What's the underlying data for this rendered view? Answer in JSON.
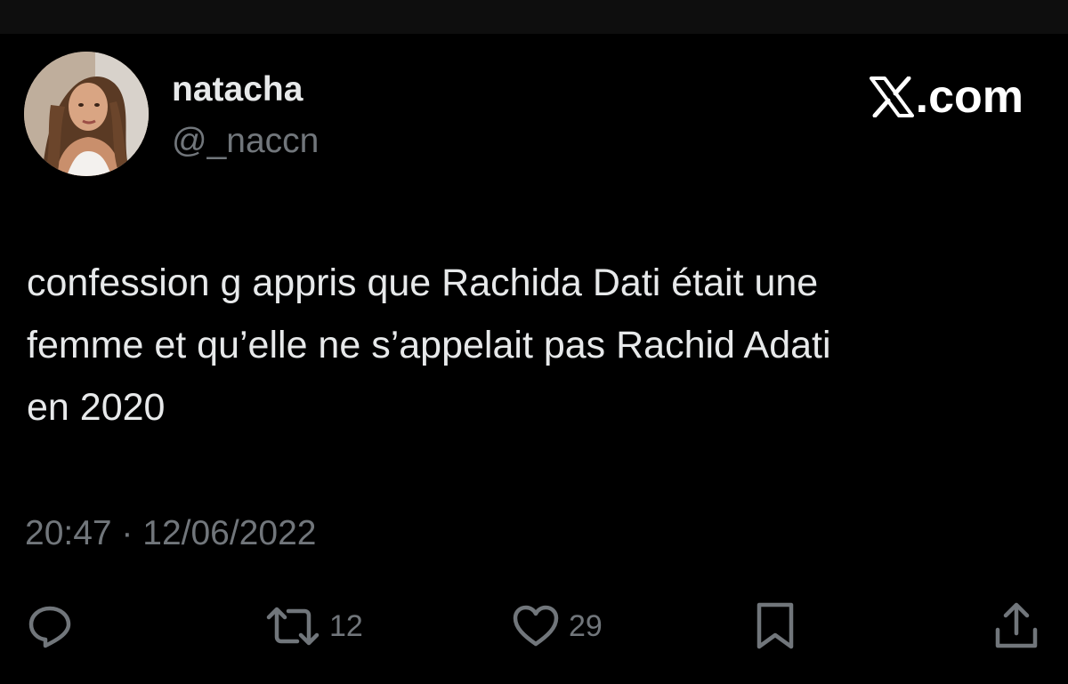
{
  "brand": {
    "logo_icon": "x-logo-icon",
    "domain_text": ".com"
  },
  "author": {
    "display_name": "natacha",
    "handle": "@_naccn",
    "avatar_icon": "profile-photo"
  },
  "tweet": {
    "text_lines": [
      "confession g appris que Rachida Dati était une",
      "femme et qu’elle ne s’appelait pas Rachid Adati",
      "en 2020"
    ],
    "timestamp": "20:47 · 12/06/2022"
  },
  "actions": {
    "reply": {
      "icon": "reply-icon"
    },
    "retweet": {
      "icon": "retweet-icon",
      "count": "12"
    },
    "like": {
      "icon": "heart-icon",
      "count": "29"
    },
    "bookmark": {
      "icon": "bookmark-icon"
    },
    "share": {
      "icon": "share-icon"
    }
  },
  "colors": {
    "background": "#000000",
    "primary_text": "#e7e9ea",
    "secondary_text": "#71767b",
    "top_strip": "#0e0e0e"
  }
}
